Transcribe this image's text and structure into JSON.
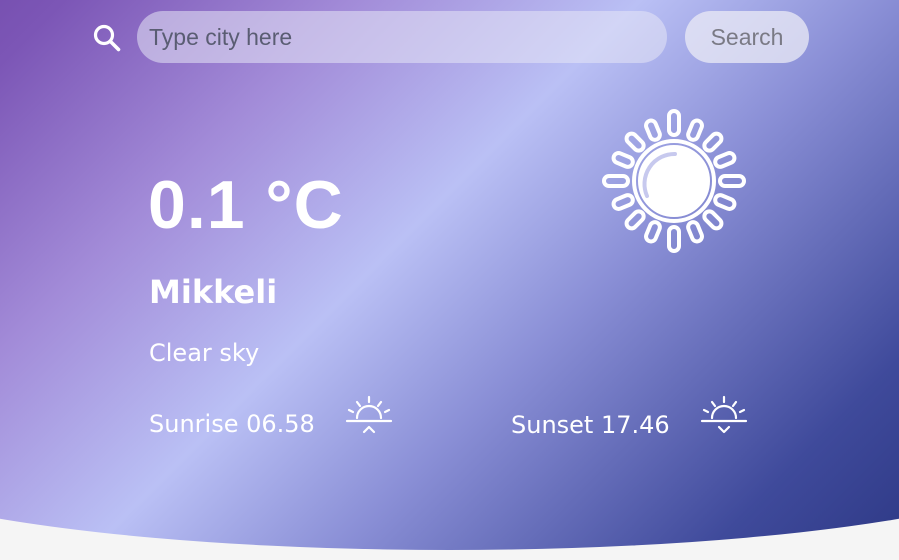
{
  "search": {
    "placeholder": "Type city here",
    "button_label": "Search"
  },
  "weather": {
    "temperature": "0.1 °C",
    "city": "Mikkeli",
    "description": "Clear sky",
    "sunrise": "Sunrise 06.58",
    "sunset": "Sunset 17.46",
    "icon": "sun-icon"
  },
  "colors": {
    "gradient": [
      "#5b2e91",
      "#a28bd8",
      "#bac0f5",
      "#3f4a9b",
      "#1f2a73"
    ],
    "page_background": "#f5f5f5",
    "text": "#ffffff"
  }
}
